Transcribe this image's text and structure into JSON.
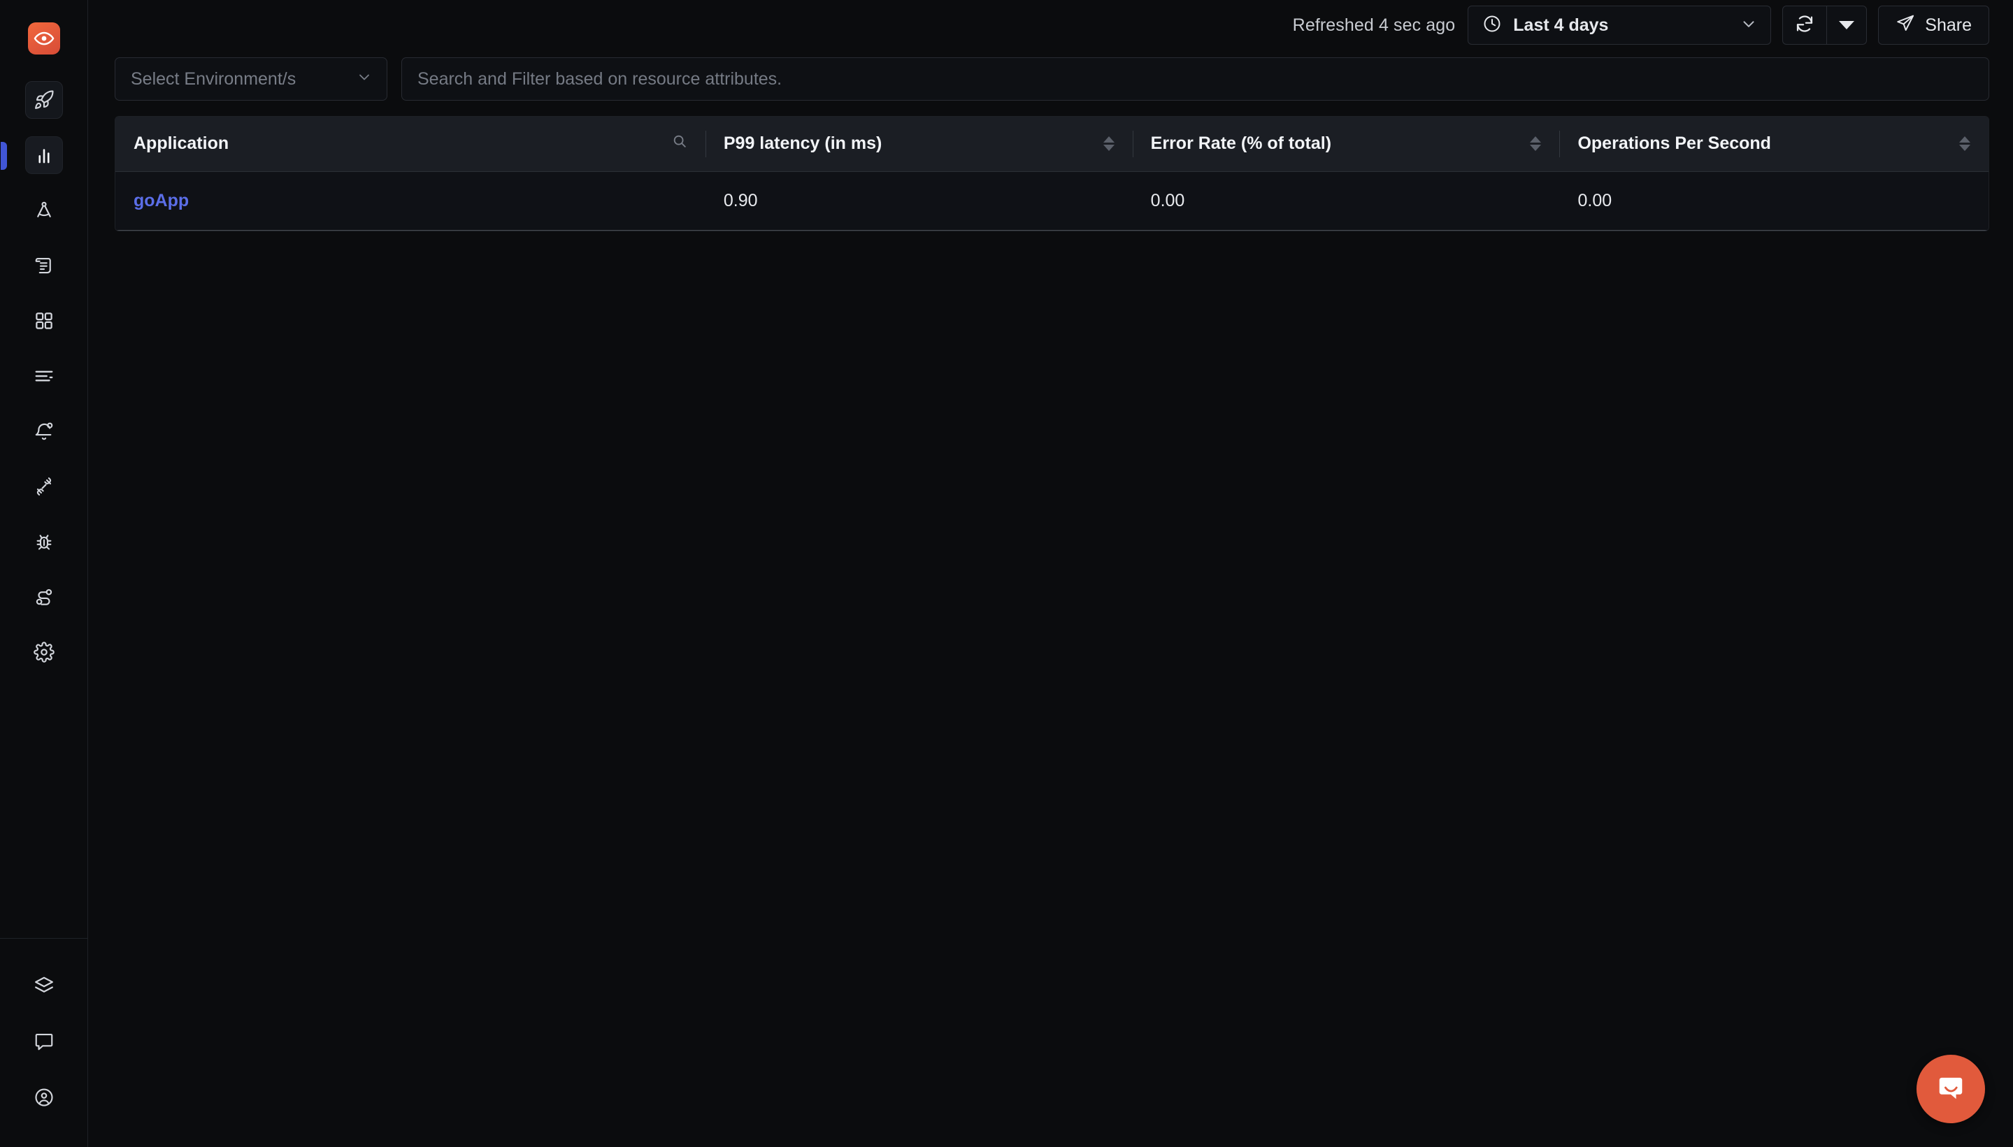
{
  "app": {
    "brand": "signoz-logo"
  },
  "sidebar": {
    "primary_items": [
      {
        "name": "get-started",
        "icon": "rocket-icon",
        "state": "boxed"
      },
      {
        "name": "services",
        "icon": "bar-chart-icon",
        "state": "active"
      },
      {
        "name": "traces",
        "icon": "compass-draft-icon",
        "state": "default"
      },
      {
        "name": "logs",
        "icon": "scroll-icon",
        "state": "default"
      },
      {
        "name": "dashboards",
        "icon": "grid-icon",
        "state": "default"
      },
      {
        "name": "billing",
        "icon": "align-left-icon",
        "state": "default"
      },
      {
        "name": "alerts",
        "icon": "bell-icon",
        "state": "default"
      },
      {
        "name": "exceptions",
        "icon": "plug-icon",
        "state": "default"
      },
      {
        "name": "issues",
        "icon": "bug-icon",
        "state": "default"
      },
      {
        "name": "service-map",
        "icon": "route-icon",
        "state": "default"
      },
      {
        "name": "settings",
        "icon": "gear-icon",
        "state": "default"
      }
    ],
    "bottom_items": [
      {
        "name": "integrations",
        "icon": "layers-icon"
      },
      {
        "name": "support",
        "icon": "message-square-icon"
      },
      {
        "name": "account",
        "icon": "user-circle-icon"
      }
    ]
  },
  "topbar": {
    "refreshed_label": "Refreshed 4 sec ago",
    "time_range": "Last 4 days",
    "time_icon": "clock-icon",
    "time_caret_icon": "chevron-down-icon",
    "refresh_icon": "refresh-icon",
    "refresh_caret_icon": "caret-down-icon",
    "share_label": "Share",
    "share_icon": "send-icon"
  },
  "filters": {
    "environment_placeholder": "Select Environment/s",
    "environment_caret_icon": "chevron-down-icon",
    "search_placeholder": "Search and Filter based on resource attributes.",
    "search_value": ""
  },
  "table": {
    "columns": [
      {
        "label": "Application",
        "icon": "search-icon",
        "sortable": false
      },
      {
        "label": "P99 latency (in ms)",
        "icon": "",
        "sortable": true
      },
      {
        "label": "Error Rate (% of total)",
        "icon": "",
        "sortable": true
      },
      {
        "label": "Operations Per Second",
        "icon": "",
        "sortable": true
      }
    ],
    "rows": [
      {
        "application": "goApp",
        "p99_latency": "0.90",
        "error_rate": "0.00",
        "operations_per_second": "0.00"
      }
    ]
  },
  "support_widget": {
    "name": "intercom-launcher",
    "icon": "chat-bubble-icon",
    "color": "#e15a3c"
  },
  "colors": {
    "accent_blue": "#5b6ee8",
    "brand_orange": "#e15a3c",
    "page_bg": "#0b0c0e",
    "panel_bg": "#0e1014",
    "header_bg": "#1b1e24"
  }
}
